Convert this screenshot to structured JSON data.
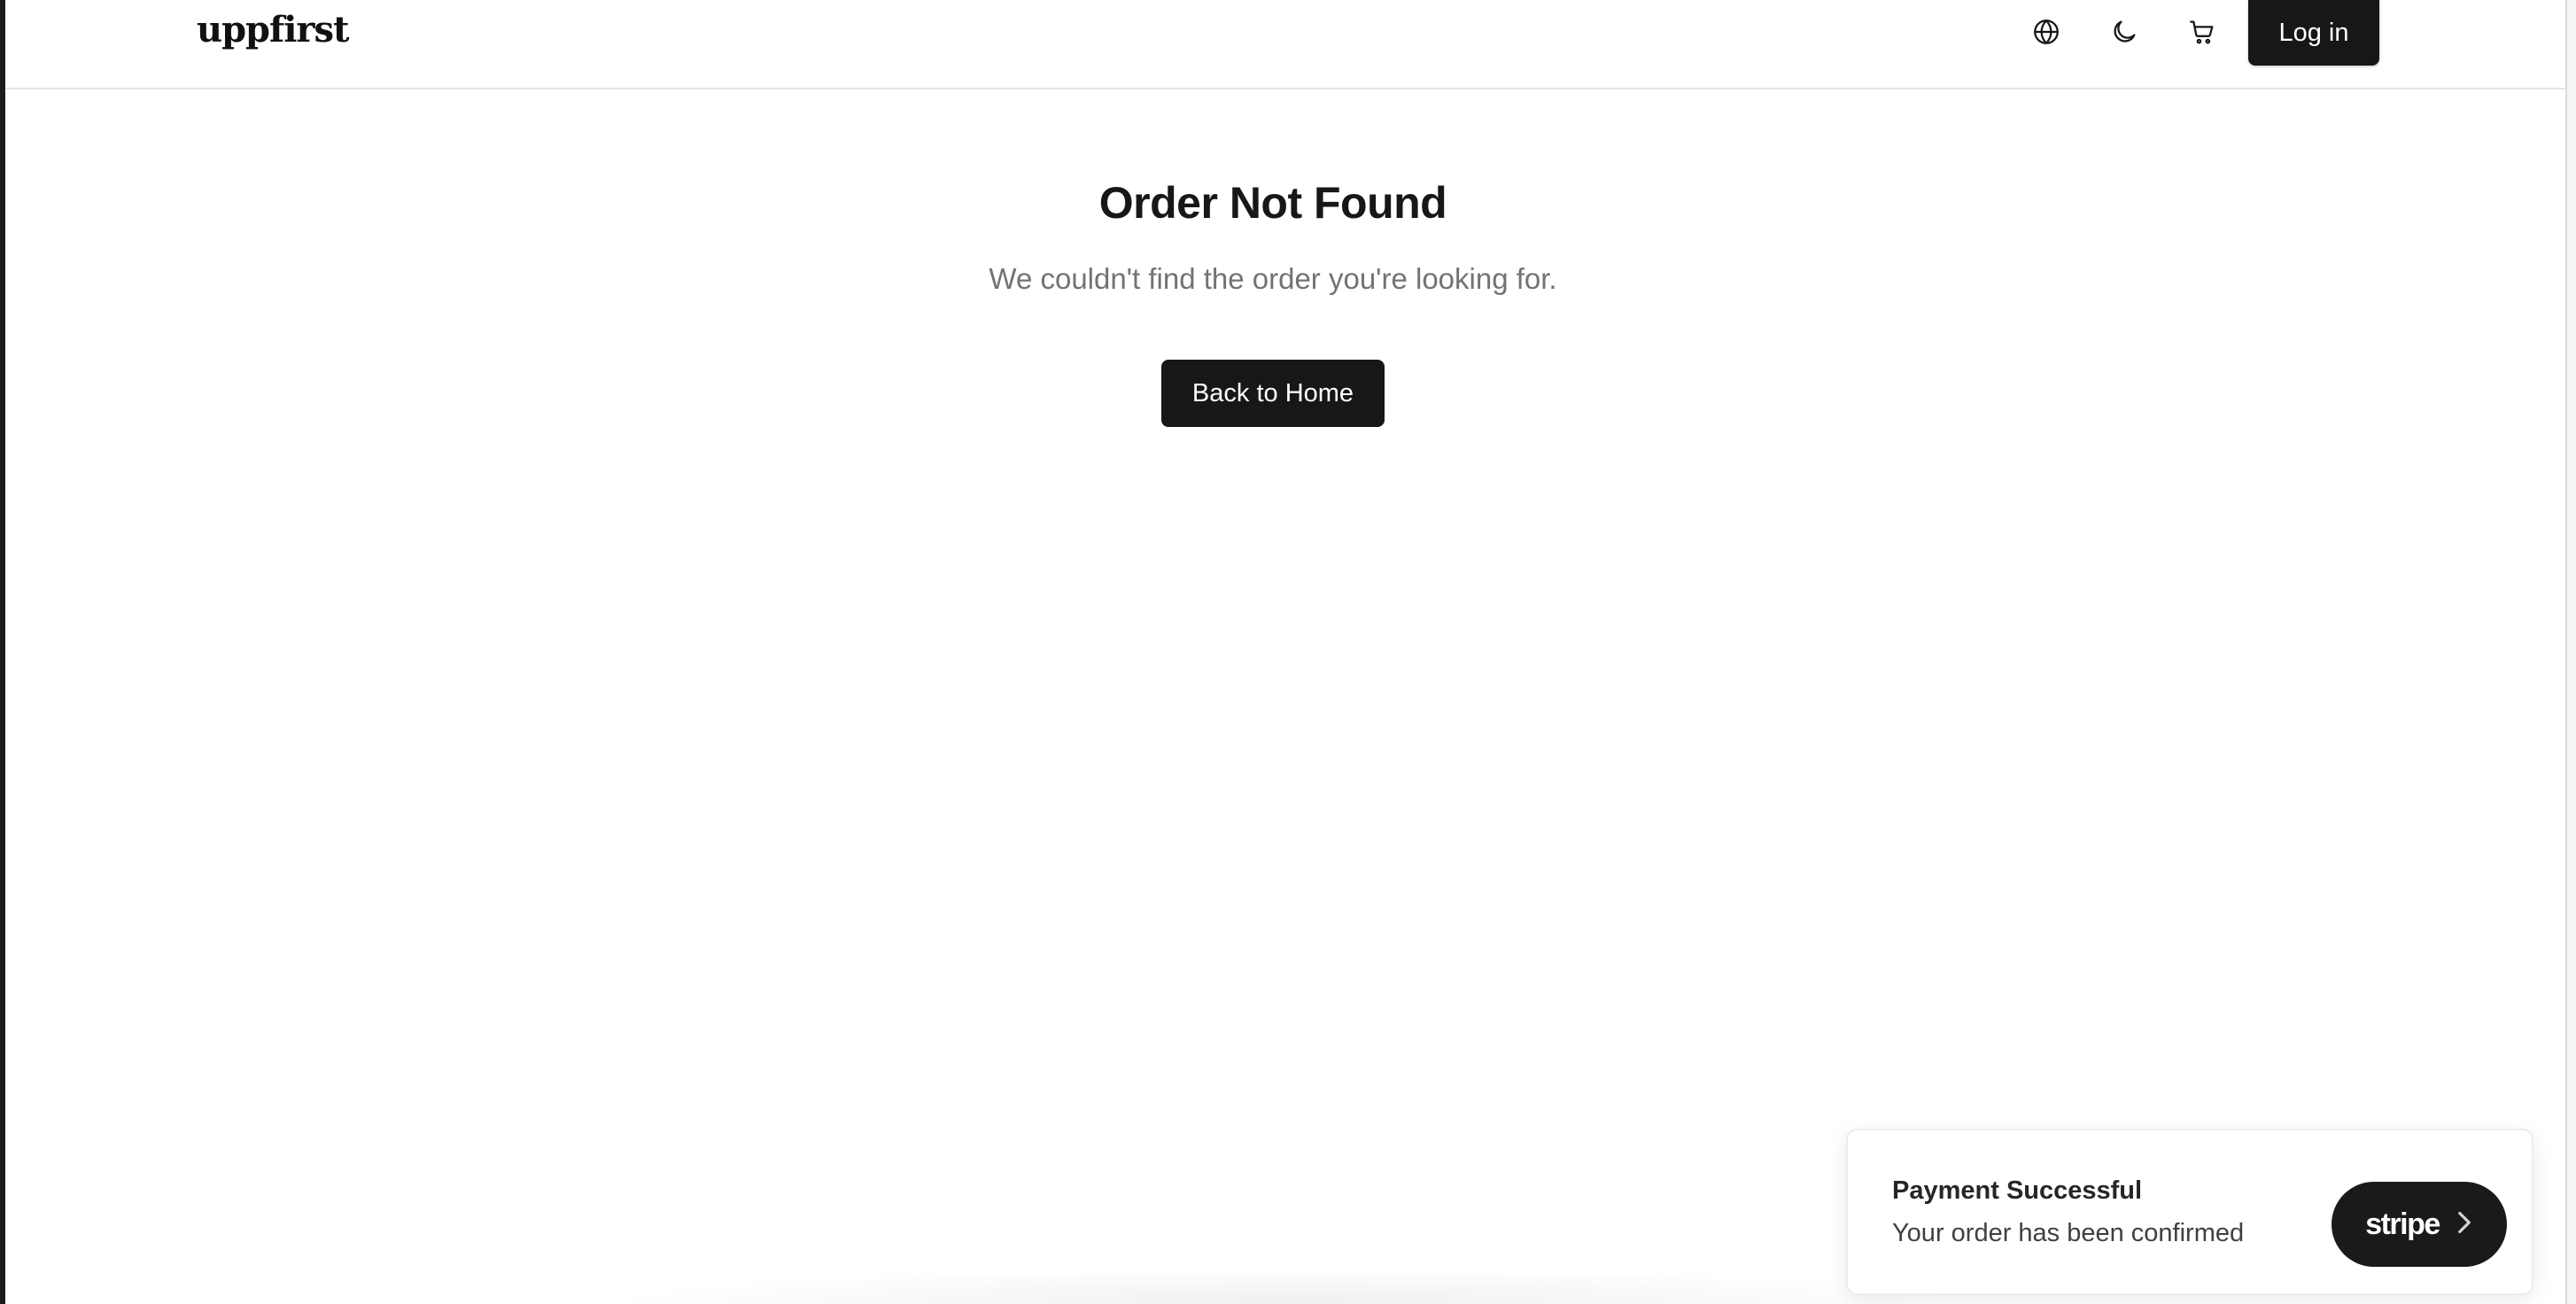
{
  "header": {
    "logo_text": "uppfirst",
    "icons": {
      "language": "globe-icon",
      "theme": "moon-icon",
      "cart": "cart-icon"
    },
    "login_label": "Log in"
  },
  "main": {
    "title": "Order Not Found",
    "subtitle": "We couldn't find the order you're looking for.",
    "back_button_label": "Back to Home"
  },
  "toast": {
    "title": "Payment Successful",
    "message": "Your order has been confirmed",
    "brand": "stripe",
    "brand_icon": "chevron-right-icon"
  },
  "colors": {
    "primary_button": "#171717",
    "text_primary": "#171717",
    "text_muted": "#737373",
    "border": "#e5e5e5",
    "background": "#ffffff"
  }
}
